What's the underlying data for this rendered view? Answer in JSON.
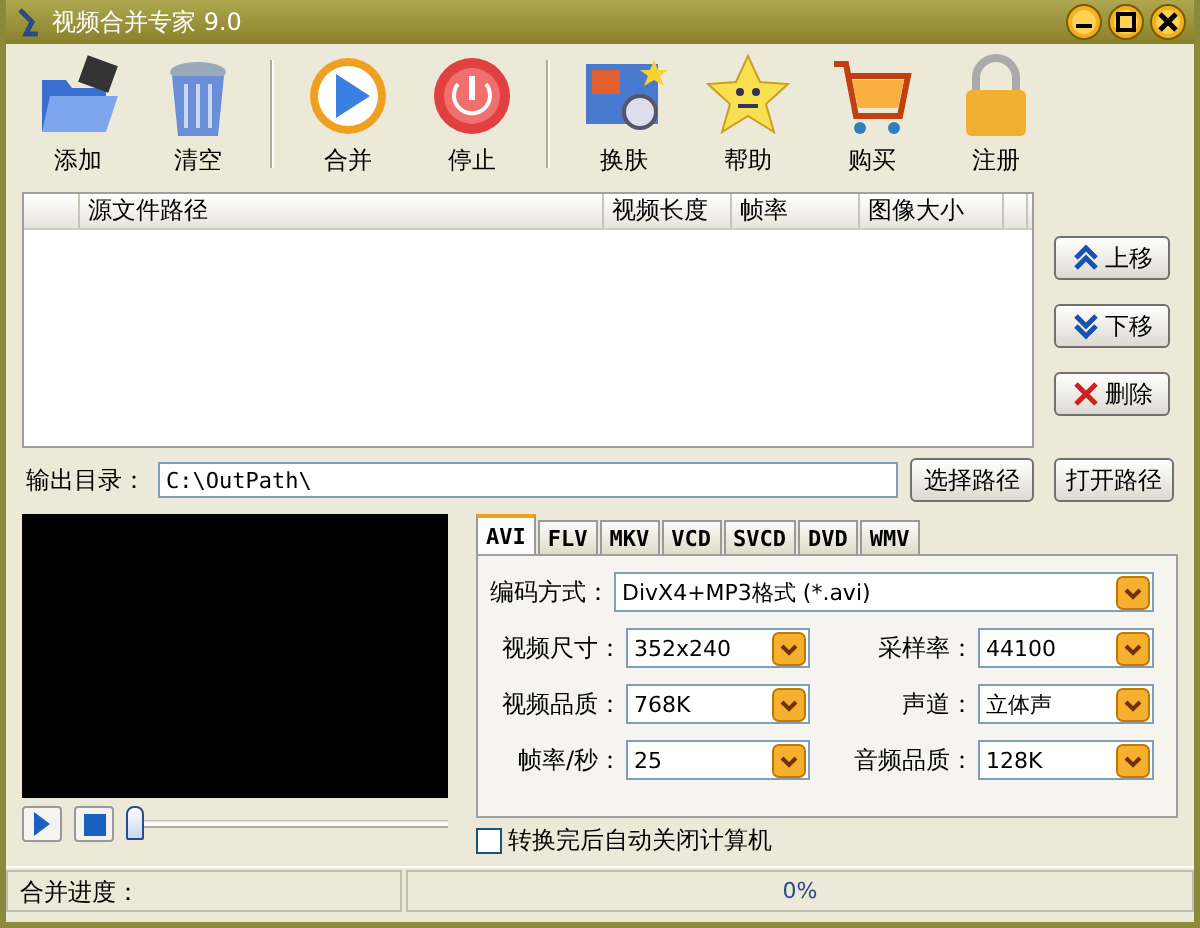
{
  "window": {
    "title": "视频合并专家 9.0"
  },
  "toolbar": {
    "groups": [
      [
        {
          "label": "添加",
          "kind": "folder"
        },
        {
          "label": "清空",
          "kind": "trash"
        }
      ],
      [
        {
          "label": "合并",
          "kind": "play"
        },
        {
          "label": "停止",
          "kind": "power"
        }
      ],
      [
        {
          "label": "换肤",
          "kind": "skin"
        },
        {
          "label": "帮助",
          "kind": "star"
        },
        {
          "label": "购买",
          "kind": "cart"
        },
        {
          "label": "注册",
          "kind": "lock"
        }
      ]
    ]
  },
  "file_list": {
    "columns": [
      "源文件路径",
      "视频长度",
      "帧率",
      "图像大小"
    ]
  },
  "side_buttons": [
    {
      "label": "上移",
      "kind": "up"
    },
    {
      "label": "下移",
      "kind": "down"
    },
    {
      "label": "删除",
      "kind": "delete"
    }
  ],
  "output": {
    "label": "输出目录：",
    "value": "C:\\OutPath\\",
    "browse_button": "选择路径",
    "open_button": "打开路径"
  },
  "player": {
    "level": 0
  },
  "tabs": [
    {
      "label": "AVI",
      "selected": true
    },
    {
      "label": "FLV",
      "selected": false
    },
    {
      "label": "MKV",
      "selected": false
    },
    {
      "label": "VCD",
      "selected": false
    },
    {
      "label": "SVCD",
      "selected": false
    },
    {
      "label": "DVD",
      "selected": false
    },
    {
      "label": "WMV",
      "selected": false
    }
  ],
  "settings": {
    "rows": [
      [
        {
          "label": "编码方式：",
          "value": "DivX4+MP3格式 (*.avi)"
        }
      ],
      [
        {
          "label": "视频尺寸：",
          "value": "352x240"
        },
        {
          "label": "采样率：",
          "value": "44100"
        }
      ],
      [
        {
          "label": "视频品质：",
          "value": "768K"
        },
        {
          "label": "声道：",
          "value": "立体声"
        }
      ],
      [
        {
          "label": "帧率/秒：",
          "value": "25"
        },
        {
          "label": "音频品质：",
          "value": "128K"
        }
      ]
    ]
  },
  "auto_shutdown": {
    "label": "转换完后自动关闭计算机",
    "checked": false
  },
  "status_bar": {
    "label": "合并进度：",
    "progress": "0%",
    "level": 0
  }
}
